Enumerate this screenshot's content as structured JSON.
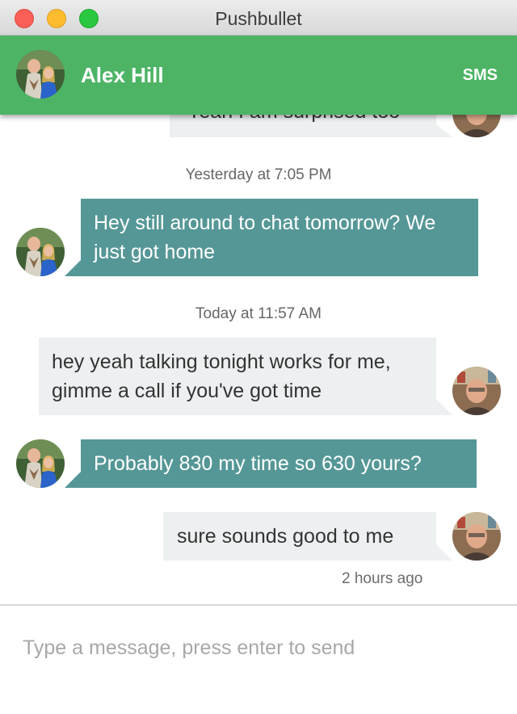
{
  "window": {
    "title": "Pushbullet"
  },
  "header": {
    "contact_name": "Alex Hill",
    "mode_label": "SMS"
  },
  "messages": [
    {
      "direction": "outgoing",
      "text": "Yeah I am surprised too"
    },
    {
      "type": "timestamp",
      "text": "Yesterday at 7:05 PM"
    },
    {
      "direction": "incoming",
      "text": "Hey still around to chat tomorrow? We just got home"
    },
    {
      "type": "timestamp",
      "text": "Today at 11:57 AM"
    },
    {
      "direction": "outgoing",
      "text": "hey yeah talking tonight works for me, gimme a call if you've got time"
    },
    {
      "direction": "incoming",
      "text": "Probably 830 my time so 630 yours?"
    },
    {
      "direction": "outgoing",
      "text": "sure sounds good to me"
    }
  ],
  "last_message_time": "2 hours ago",
  "composer": {
    "placeholder": "Type a message, press enter to send"
  },
  "colors": {
    "header_green": "#4db466",
    "incoming_bubble": "#559796",
    "outgoing_bubble": "#edf0f1"
  }
}
